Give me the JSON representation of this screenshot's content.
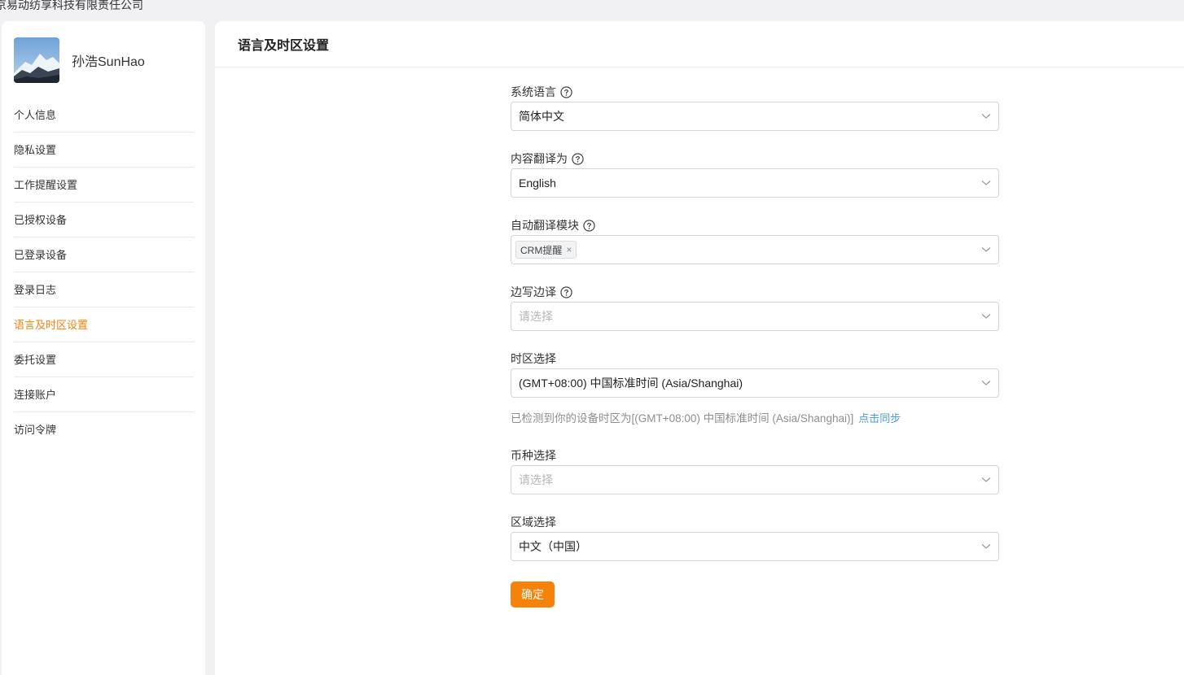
{
  "company": {
    "name": "京易动纺享科技有限责任公司"
  },
  "user": {
    "name": "孙浩SunHao"
  },
  "sidebar": {
    "items": [
      {
        "label": "个人信息",
        "active": false
      },
      {
        "label": "隐私设置",
        "active": false
      },
      {
        "label": "工作提醒设置",
        "active": false
      },
      {
        "label": "已授权设备",
        "active": false
      },
      {
        "label": "已登录设备",
        "active": false
      },
      {
        "label": "登录日志",
        "active": false
      },
      {
        "label": "语言及时区设置",
        "active": true
      },
      {
        "label": "委托设置",
        "active": false
      },
      {
        "label": "连接账户",
        "active": false
      },
      {
        "label": "访问令牌",
        "active": false
      }
    ]
  },
  "main": {
    "title": "语言及时区设置"
  },
  "form": {
    "system_language": {
      "label": "系统语言",
      "value": "简体中文"
    },
    "translate_to": {
      "label": "内容翻译为",
      "value": "English"
    },
    "auto_translate": {
      "label": "自动翻译模块",
      "tags": [
        "CRM提醒"
      ],
      "tag_close": "×"
    },
    "side_translate": {
      "label": "边写边译",
      "placeholder": "请选择"
    },
    "timezone": {
      "label": "时区选择",
      "value": "(GMT+08:00) 中国标准时间 (Asia/Shanghai)",
      "hint": "已检测到你的设备时区为[(GMT+08:00) 中国标准时间 (Asia/Shanghai)]",
      "sync_link": "点击同步"
    },
    "currency": {
      "label": "币种选择",
      "placeholder": "请选择"
    },
    "region": {
      "label": "区域选择",
      "value": "中文（中国）"
    },
    "confirm": "确定"
  },
  "colors": {
    "accent": "#f5820a",
    "link": "#4a9be6"
  },
  "icons": {
    "help": "question-circle-icon",
    "dropdown": "chevron-down-icon",
    "remove": "close-icon"
  }
}
